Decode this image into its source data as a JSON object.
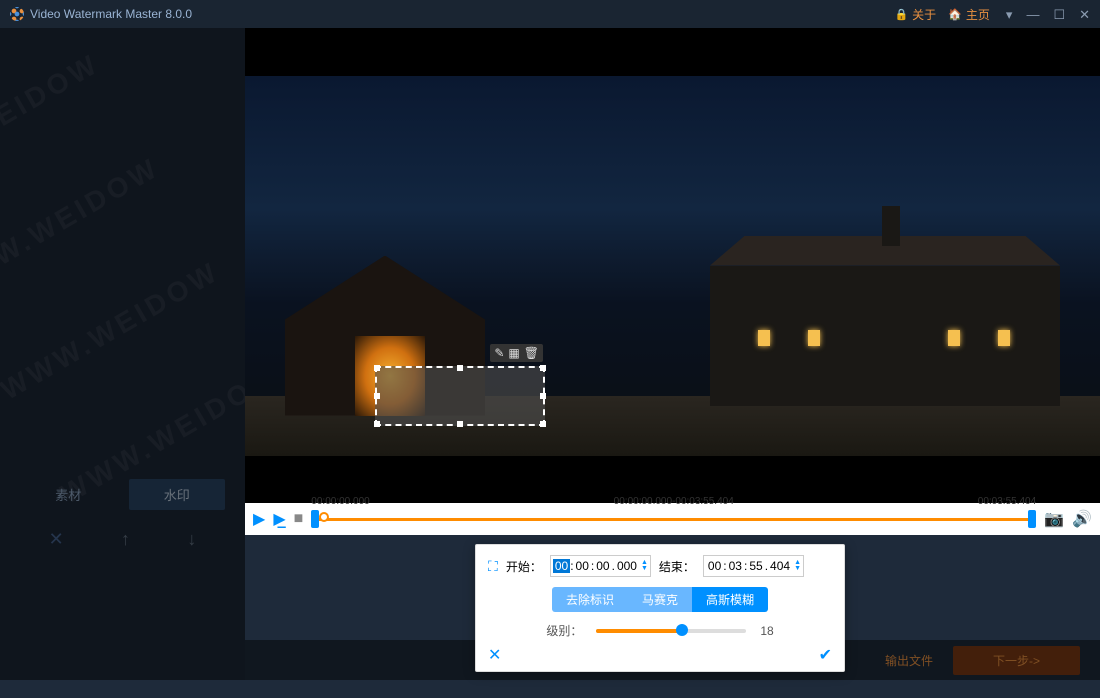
{
  "titlebar": {
    "title": "Video Watermark Master 8.0.0",
    "about": "关于",
    "home": "主页"
  },
  "sidebar": {
    "watermark_text": "WWW.WEIDOWN.COM",
    "tab_material": "素材",
    "tab_watermark": "水印"
  },
  "player": {
    "start_time": "00:00:00.000",
    "range": "00:00:00.000-00:03:55.404",
    "end_time": "00:03:55.404"
  },
  "popup": {
    "start_label": "开始：",
    "start_h": "00",
    "start_m": "00",
    "start_s": "00",
    "start_ms": "000",
    "end_label": "结束：",
    "end_h": "00",
    "end_m": "03",
    "end_s": "55",
    "end_ms": "404",
    "btn_remove": "去除标识",
    "btn_mosaic": "马赛克",
    "btn_gauss": "高斯模糊",
    "level_label": "级别：",
    "level_value": "18"
  },
  "bottom": {
    "output_label": "输出文件",
    "next_label": "下一步->"
  }
}
